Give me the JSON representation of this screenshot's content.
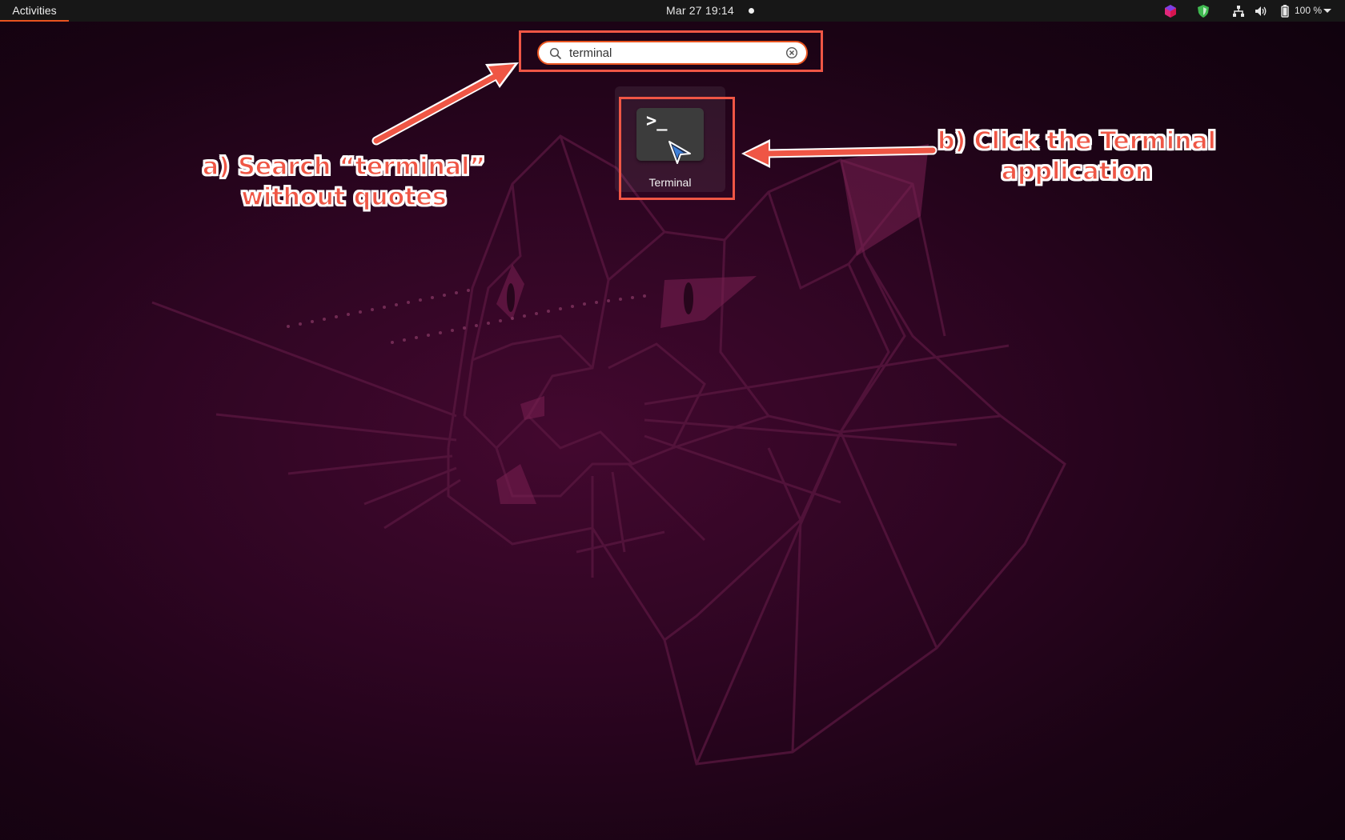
{
  "topbar": {
    "activities_label": "Activities",
    "clock": "Mar 27  19:14",
    "battery_percent": "100 %",
    "tray_icons": [
      "app-indicator-icon",
      "shield-icon",
      "network-icon",
      "volume-icon",
      "battery-icon",
      "system-menu-arrow-icon"
    ]
  },
  "search": {
    "value": "terminal",
    "icon": "search-icon",
    "clear_icon": "clear-icon"
  },
  "results": {
    "apps": [
      {
        "label": "Terminal",
        "icon": "terminal-icon",
        "glyph": ">_"
      }
    ]
  },
  "annotations": {
    "a_line1": "a) Search “terminal”",
    "a_line2": "without quotes",
    "b_line1": "b) Click the Terminal",
    "b_line2": "application",
    "color": "#ef5645"
  },
  "colors": {
    "accent": "#e95420",
    "annotation": "#ef5645",
    "topbar": "#171717"
  }
}
